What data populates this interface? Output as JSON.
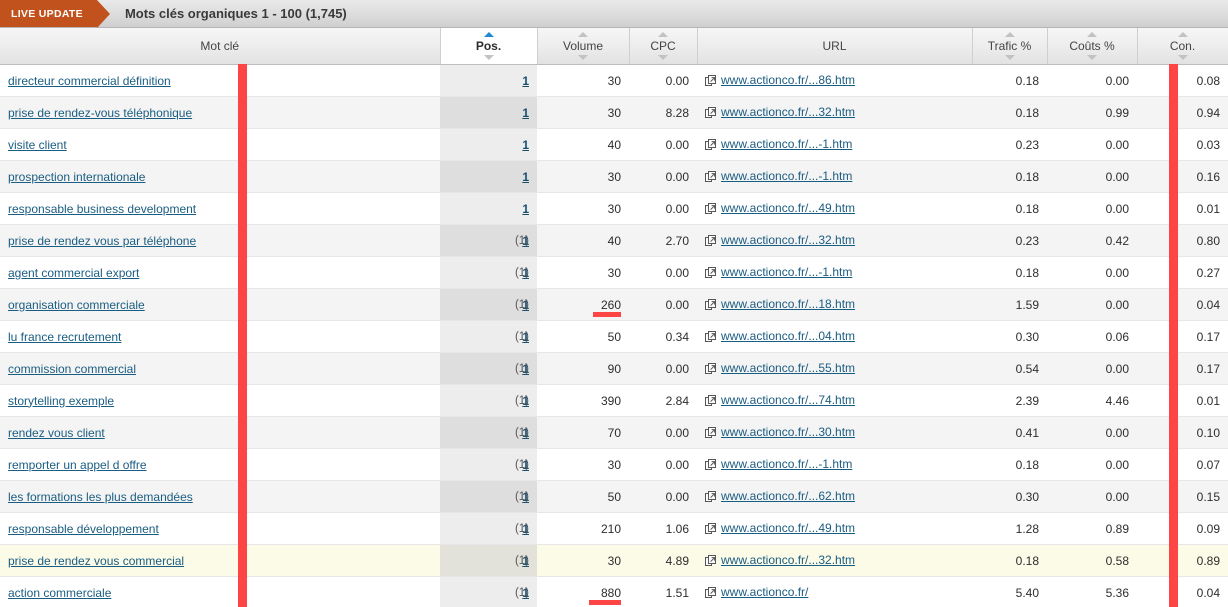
{
  "header": {
    "live_badge": "LIVE UPDATE",
    "title": "Mots clés organiques 1 - 100 (1,745)",
    "badge_color": "#c2521d"
  },
  "colors": {
    "marker_red": "#fc4544",
    "link_blue": "#1a5d82",
    "sort_active": "#1f8ad2",
    "highlight_row": "#fbfbe8"
  },
  "table": {
    "columns": [
      {
        "key": "keyword",
        "label": "Mot clé",
        "align": "left",
        "sorted": false,
        "sort_dir": ""
      },
      {
        "key": "position",
        "label": "Pos.",
        "align": "right",
        "sorted": true,
        "sort_dir": "asc"
      },
      {
        "key": "volume",
        "label": "Volume",
        "align": "right",
        "sorted": false,
        "sort_dir": ""
      },
      {
        "key": "cpc",
        "label": "CPC",
        "align": "right",
        "sorted": false,
        "sort_dir": ""
      },
      {
        "key": "url",
        "label": "URL",
        "align": "left",
        "sorted": false,
        "sort_dir": ""
      },
      {
        "key": "traffic",
        "label": "Trafic %",
        "align": "right",
        "sorted": false,
        "sort_dir": ""
      },
      {
        "key": "costs",
        "label": "Coûts %",
        "align": "right",
        "sorted": false,
        "sort_dir": ""
      },
      {
        "key": "con",
        "label": "Con.",
        "align": "right",
        "sorted": false,
        "sort_dir": ""
      }
    ],
    "link_icon": "external-link-icon",
    "rows": [
      {
        "keyword": "directeur commercial définition",
        "position": "1",
        "position_sub": "",
        "volume": "30",
        "volume_bar": 0,
        "cpc": "0.00",
        "url": "www.actionco.fr/...86.htm",
        "traffic": "0.18",
        "costs": "0.00",
        "con": "0.08",
        "highlight": false
      },
      {
        "keyword": "prise de rendez-vous téléphonique",
        "position": "1",
        "position_sub": "",
        "volume": "30",
        "volume_bar": 0,
        "cpc": "8.28",
        "url": "www.actionco.fr/...32.htm",
        "traffic": "0.18",
        "costs": "0.99",
        "con": "0.94",
        "highlight": false
      },
      {
        "keyword": "visite client",
        "position": "1",
        "position_sub": "",
        "volume": "40",
        "volume_bar": 0,
        "cpc": "0.00",
        "url": "www.actionco.fr/...-1.htm",
        "traffic": "0.23",
        "costs": "0.00",
        "con": "0.03",
        "highlight": false
      },
      {
        "keyword": "prospection internationale",
        "position": "1",
        "position_sub": "",
        "volume": "30",
        "volume_bar": 0,
        "cpc": "0.00",
        "url": "www.actionco.fr/...-1.htm",
        "traffic": "0.18",
        "costs": "0.00",
        "con": "0.16",
        "highlight": false
      },
      {
        "keyword": "responsable business development",
        "position": "1",
        "position_sub": "",
        "volume": "30",
        "volume_bar": 0,
        "cpc": "0.00",
        "url": "www.actionco.fr/...49.htm",
        "traffic": "0.18",
        "costs": "0.00",
        "con": "0.01",
        "highlight": false
      },
      {
        "keyword": "prise de rendez vous par téléphone",
        "position": "1",
        "position_sub": "(1)",
        "volume": "40",
        "volume_bar": 0,
        "cpc": "2.70",
        "url": "www.actionco.fr/...32.htm",
        "traffic": "0.23",
        "costs": "0.42",
        "con": "0.80",
        "highlight": false
      },
      {
        "keyword": "agent commercial export",
        "position": "1",
        "position_sub": "(1)",
        "volume": "30",
        "volume_bar": 0,
        "cpc": "0.00",
        "url": "www.actionco.fr/...-1.htm",
        "traffic": "0.18",
        "costs": "0.00",
        "con": "0.27",
        "highlight": false
      },
      {
        "keyword": "organisation commerciale",
        "position": "1",
        "position_sub": "(1)",
        "volume": "260",
        "volume_bar": 28,
        "cpc": "0.00",
        "url": "www.actionco.fr/...18.htm",
        "traffic": "1.59",
        "costs": "0.00",
        "con": "0.04",
        "highlight": false
      },
      {
        "keyword": "lu france recrutement",
        "position": "1",
        "position_sub": "(1)",
        "volume": "50",
        "volume_bar": 0,
        "cpc": "0.34",
        "url": "www.actionco.fr/...04.htm",
        "traffic": "0.30",
        "costs": "0.06",
        "con": "0.17",
        "highlight": false
      },
      {
        "keyword": "commission commercial",
        "position": "1",
        "position_sub": "(1)",
        "volume": "90",
        "volume_bar": 0,
        "cpc": "0.00",
        "url": "www.actionco.fr/...55.htm",
        "traffic": "0.54",
        "costs": "0.00",
        "con": "0.17",
        "highlight": false
      },
      {
        "keyword": "storytelling exemple",
        "position": "1",
        "position_sub": "(1)",
        "volume": "390",
        "volume_bar": 0,
        "cpc": "2.84",
        "url": "www.actionco.fr/...74.htm",
        "traffic": "2.39",
        "costs": "4.46",
        "con": "0.01",
        "highlight": false
      },
      {
        "keyword": "rendez vous client",
        "position": "1",
        "position_sub": "(1)",
        "volume": "70",
        "volume_bar": 0,
        "cpc": "0.00",
        "url": "www.actionco.fr/...30.htm",
        "traffic": "0.41",
        "costs": "0.00",
        "con": "0.10",
        "highlight": false
      },
      {
        "keyword": "remporter un appel d offre",
        "position": "1",
        "position_sub": "(1)",
        "volume": "30",
        "volume_bar": 0,
        "cpc": "0.00",
        "url": "www.actionco.fr/...-1.htm",
        "traffic": "0.18",
        "costs": "0.00",
        "con": "0.07",
        "highlight": false
      },
      {
        "keyword": "les formations les plus demandées",
        "position": "1",
        "position_sub": "(1)",
        "volume": "50",
        "volume_bar": 0,
        "cpc": "0.00",
        "url": "www.actionco.fr/...62.htm",
        "traffic": "0.30",
        "costs": "0.00",
        "con": "0.15",
        "highlight": false
      },
      {
        "keyword": "responsable développement",
        "position": "1",
        "position_sub": "(1)",
        "volume": "210",
        "volume_bar": 0,
        "cpc": "1.06",
        "url": "www.actionco.fr/...49.htm",
        "traffic": "1.28",
        "costs": "0.89",
        "con": "0.09",
        "highlight": false
      },
      {
        "keyword": "prise de rendez vous commercial",
        "position": "1",
        "position_sub": "(1)",
        "volume": "30",
        "volume_bar": 0,
        "cpc": "4.89",
        "url": "www.actionco.fr/...32.htm",
        "traffic": "0.18",
        "costs": "0.58",
        "con": "0.89",
        "highlight": true
      },
      {
        "keyword": "action commerciale",
        "position": "1",
        "position_sub": "(1)",
        "volume": "880",
        "volume_bar": 32,
        "cpc": "1.51",
        "url": "www.actionco.fr/",
        "traffic": "5.40",
        "costs": "5.36",
        "con": "0.04",
        "highlight": false
      }
    ]
  }
}
